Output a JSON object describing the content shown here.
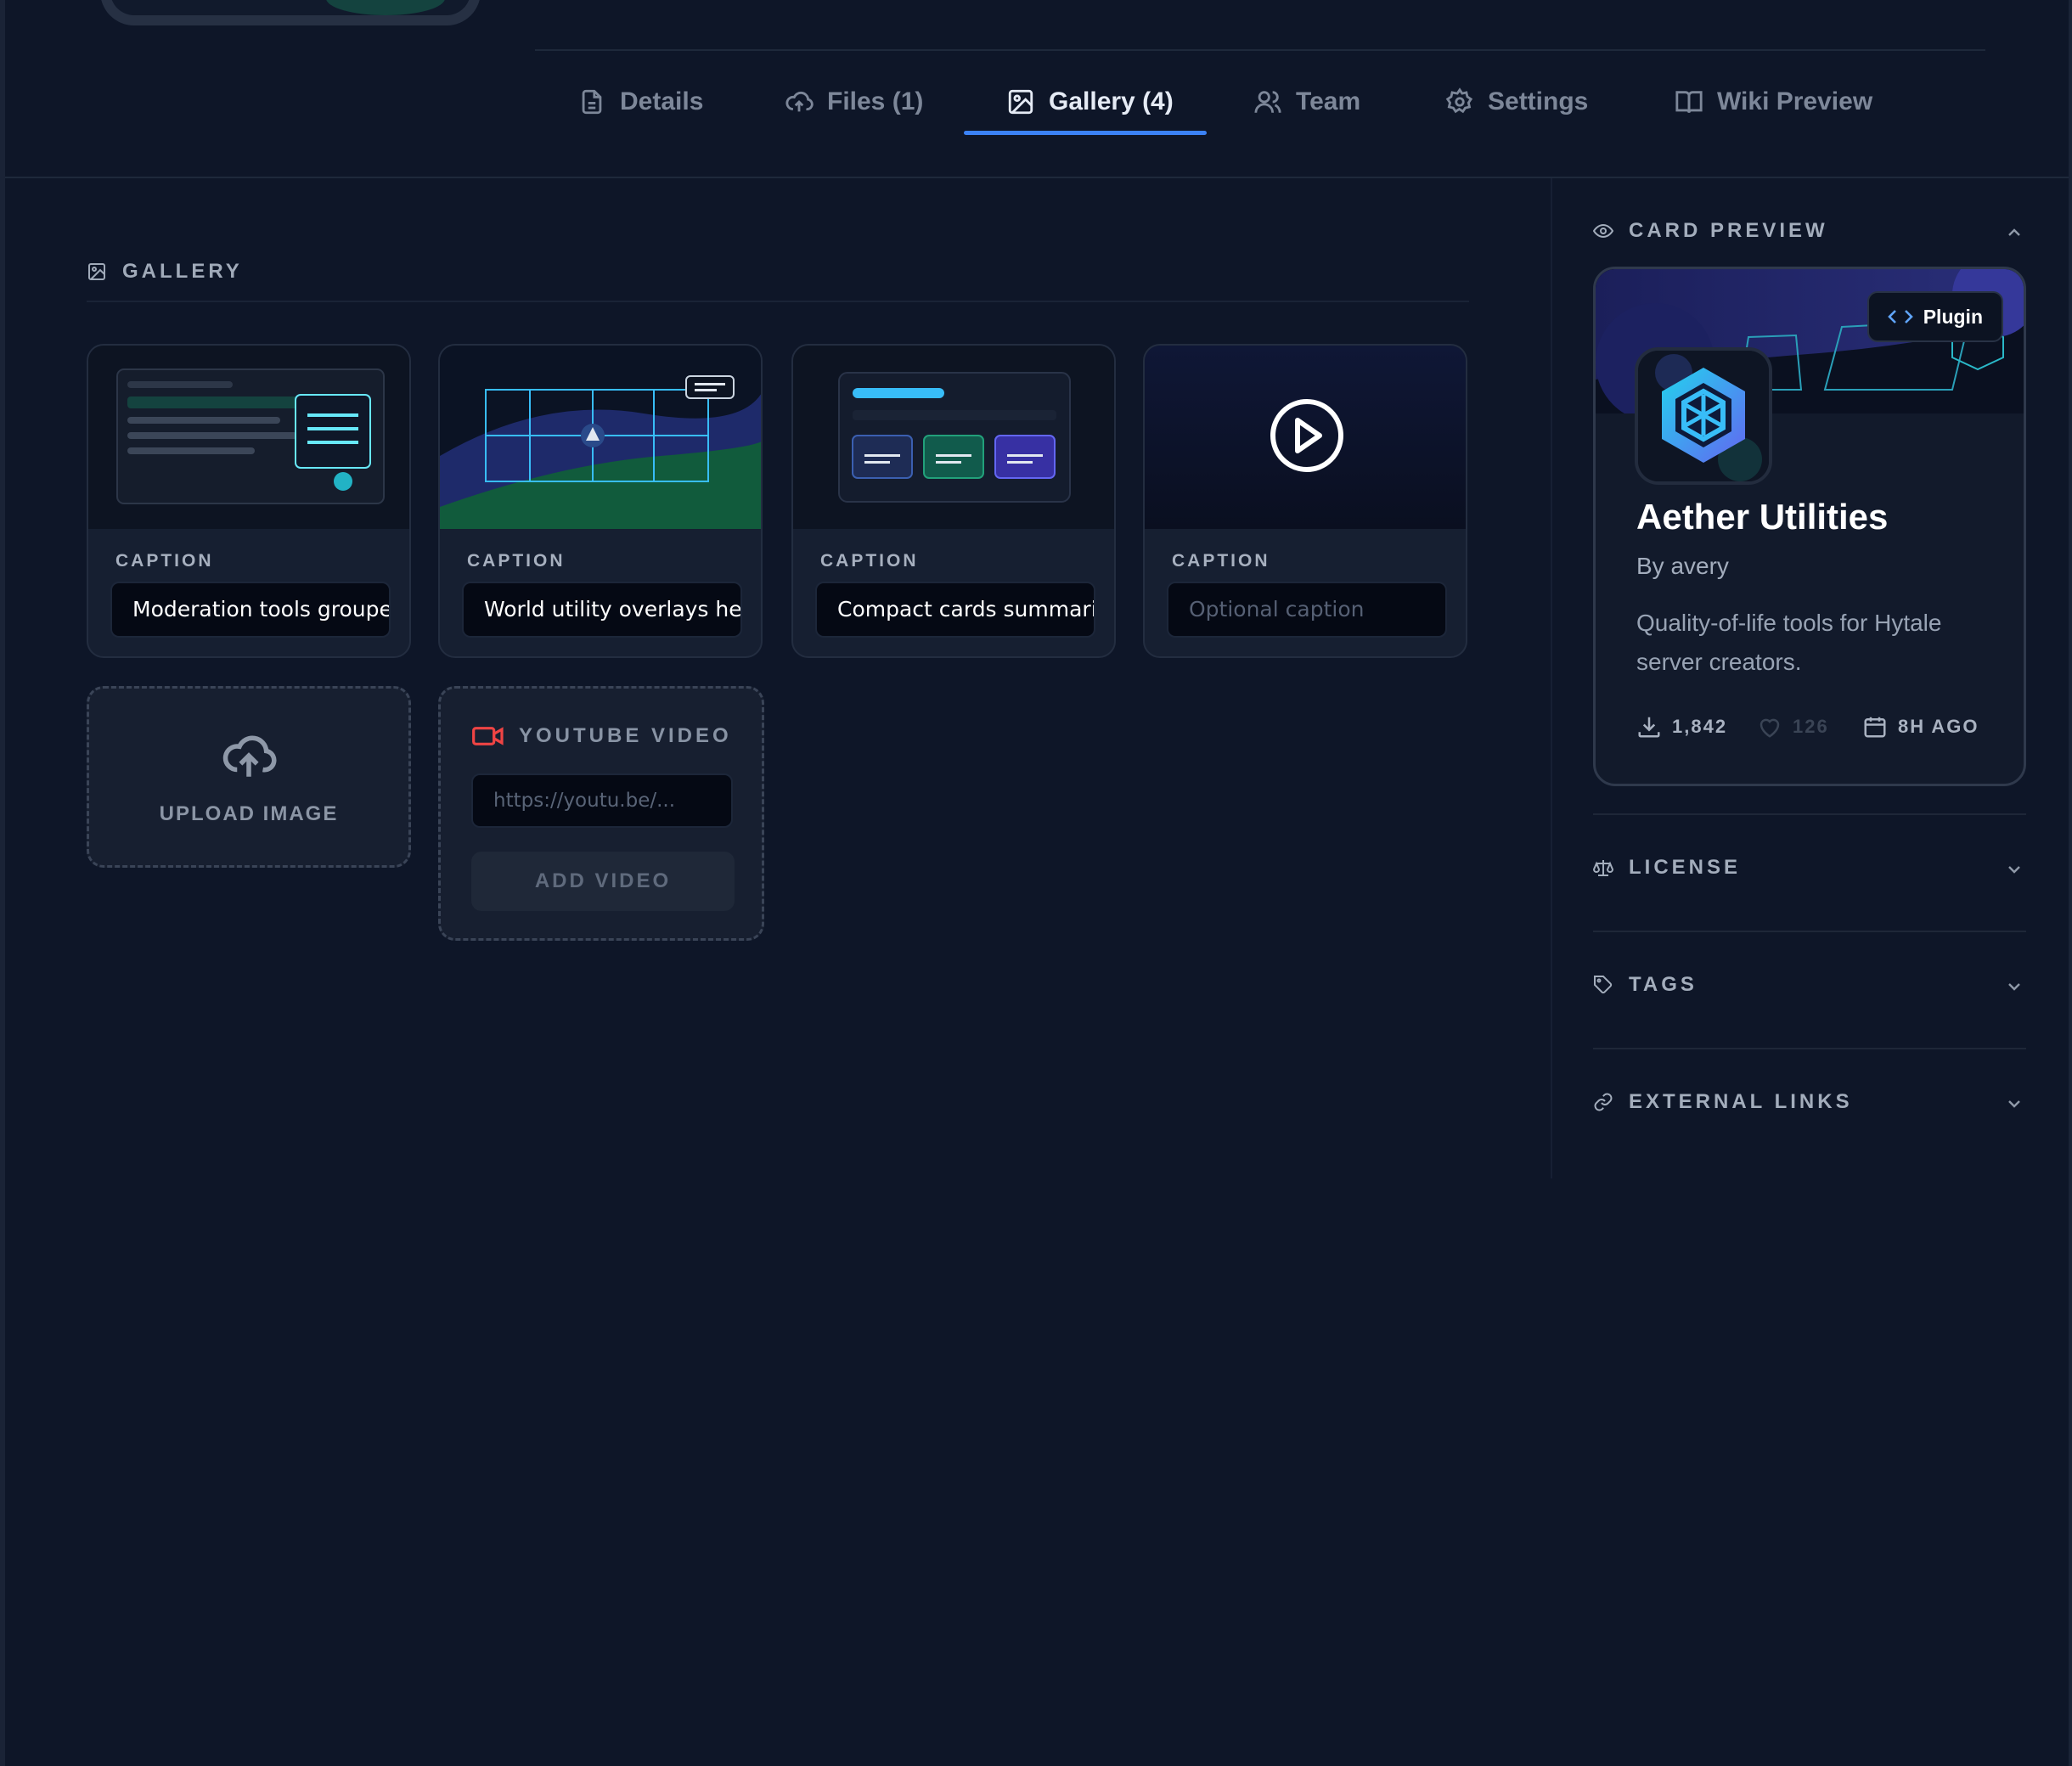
{
  "tabs": [
    {
      "label": "Details",
      "icon": "file-icon",
      "active": false
    },
    {
      "label": "Files (1)",
      "icon": "cloud-upload-icon",
      "active": false
    },
    {
      "label": "Gallery (4)",
      "icon": "image-icon",
      "active": true
    },
    {
      "label": "Team",
      "icon": "users-icon",
      "active": false
    },
    {
      "label": "Settings",
      "icon": "gear-icon",
      "active": false
    },
    {
      "label": "Wiki Preview",
      "icon": "book-icon",
      "active": false
    }
  ],
  "gallery": {
    "title": "GALLERY",
    "caption_label": "CAPTION",
    "items": [
      {
        "caption": "Moderation tools groupe",
        "type": "image"
      },
      {
        "caption": "World utility overlays hel|",
        "type": "image"
      },
      {
        "caption": "Compact cards summari:",
        "type": "image"
      },
      {
        "caption": "",
        "placeholder": "Optional caption",
        "type": "video"
      }
    ],
    "upload_label": "UPLOAD IMAGE",
    "youtube": {
      "title": "YOUTUBE VIDEO",
      "placeholder": "https://youtu.be/...",
      "button": "ADD VIDEO"
    }
  },
  "sidebar": {
    "card_preview": {
      "heading": "CARD PREVIEW",
      "badge": "Plugin",
      "title": "Aether Utilities",
      "author": "By avery",
      "description": "Quality-of-life tools for Hytale server creators.",
      "downloads": "1,842",
      "likes": "126",
      "updated": "8H AGO"
    },
    "sections": [
      {
        "heading": "LICENSE",
        "icon": "scale-icon"
      },
      {
        "heading": "TAGS",
        "icon": "tag-icon"
      },
      {
        "heading": "EXTERNAL LINKS",
        "icon": "link-icon"
      }
    ]
  },
  "colors": {
    "background": "#0e1628",
    "accent": "#3b82f6",
    "youtube": "#ef4444"
  }
}
